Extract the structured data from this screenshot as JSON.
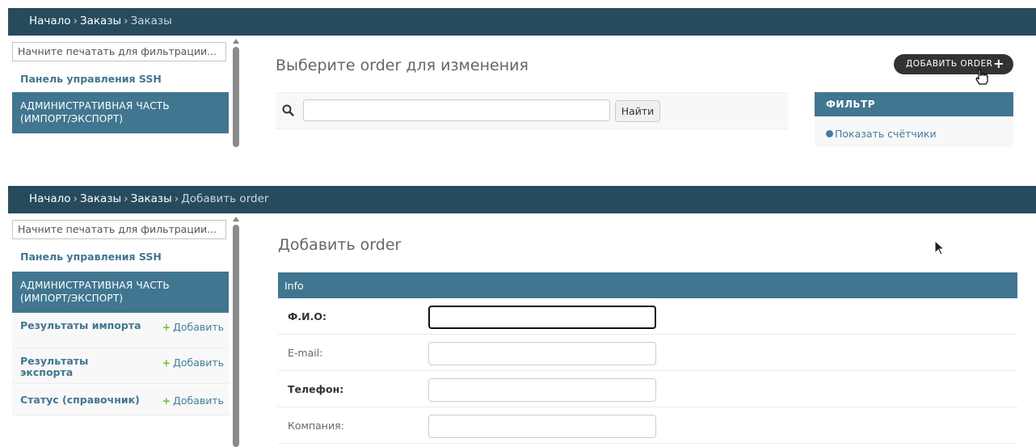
{
  "change_list": {
    "breadcrumbs": [
      {
        "label": "Начало",
        "current": false
      },
      {
        "label": "Заказы",
        "current": false
      },
      {
        "label": "Заказы",
        "current": true
      }
    ],
    "sidebar": {
      "filter_placeholder": "Начните печатать для фильтрации...",
      "app_title": "Панель управления SSH",
      "app_header": "АДМИНИСТРАТИВНАЯ ЧАСТЬ (ИМПОРТ/ЭКСПОРТ)"
    },
    "title": "Выберите order для изменения",
    "add_button_label": "ДОБАВИТЬ ORDER",
    "search": {
      "button_label": "Найти",
      "value": ""
    },
    "filter": {
      "header": "ФИЛЬТР",
      "option": "Показать счётчики"
    }
  },
  "add_form": {
    "breadcrumbs": [
      {
        "label": "Начало",
        "current": false
      },
      {
        "label": "Заказы",
        "current": false
      },
      {
        "label": "Заказы",
        "current": false
      },
      {
        "label": "Добавить order",
        "current": true
      }
    ],
    "sidebar": {
      "filter_placeholder": "Начните печатать для фильтрации...",
      "app_title": "Панель управления SSH",
      "app_header": "АДМИНИСТРАТИВНАЯ ЧАСТЬ (ИМПОРТ/ЭКСПОРТ)",
      "models": [
        {
          "name": "Результаты импорта",
          "add_label": "Добавить"
        },
        {
          "name": "Результаты экспорта",
          "add_label": "Добавить"
        },
        {
          "name": "Статус (справочник)",
          "add_label": "Добавить"
        }
      ]
    },
    "title": "Добавить order",
    "fieldset_title": "Info",
    "fields": [
      {
        "label": "Ф.И.О:",
        "required": true,
        "value": ""
      },
      {
        "label": "E-mail:",
        "required": false,
        "value": ""
      },
      {
        "label": "Телефон:",
        "required": true,
        "value": ""
      },
      {
        "label": "Компания:",
        "required": false,
        "value": ""
      }
    ]
  },
  "colors": {
    "header_bg": "#264b5d",
    "accent": "#417690",
    "add_link": "#70bf2b",
    "button_dark": "#333333"
  }
}
